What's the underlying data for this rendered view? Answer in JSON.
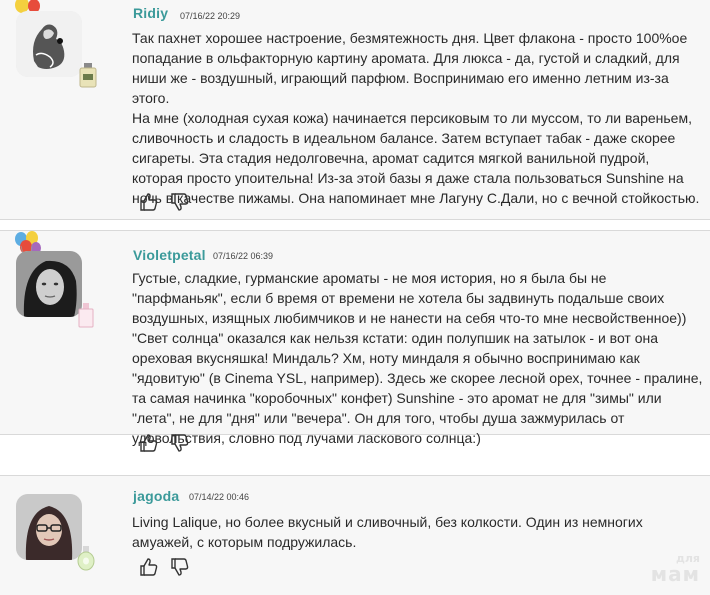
{
  "toolbar": {
    "icons": [
      "badge-icon",
      "thermometer-icon",
      "umbrella-icon",
      "thumbs-icon",
      "info-icon",
      "refresh-icon"
    ]
  },
  "reviews": [
    {
      "username": "Ridiy",
      "datetime": "07/16/22 20:29",
      "paragraphs": [
        "Так пахнет хорошее настроение, безмятежность дня. Цвет флакона - просто 100%ое попадание в ольфакторную картину аромата. Для люкса - да, густой и сладкий, для ниши же - воздушный, играющий парфюм. Воспринимаю его именно летним из-за этого.",
        "На мне (холодная сухая кожа) начинается персиковым то ли муссом, то ли вареньем, сливочность и сладость в идеальном балансе. Затем вступает табак - даже скорее сигареты. Эта стадия недолговечна, аромат садится мягкой ванильной пудрой, которая просто упоительна! Из-за этой базы я даже стала пользоваться Sunshine на ночь в качестве пижамы. Она напоминает мне Лагуну С.Дали, но с вечной стойкостью."
      ]
    },
    {
      "username": "Violetpetal",
      "datetime": "07/16/22 06:39",
      "paragraphs": [
        "Густые, сладкие, гурманские ароматы - не моя история, но я была бы не \"парфманьяк\", если б время от времени не хотела бы задвинуть подальше своих воздушных, изящных любимчиков и не нанести на себя что-то мне несвойственное)) \"Свет солнца\" оказался как нельзя кстати: один полупшик на затылок - и вот она ореховая вкусняшка! Миндаль? Хм, ноту миндаля я обычно воспринимаю как \"ядовитую\" (в Cinema YSL, например). Здесь же скорее лесной орех, точнее - пралине, та самая начинка \"коробочных\" конфет) Sunshine - это аромат не для \"зимы\" или \"лета\", не для \"дня\" или \"вечера\". Он для того, чтобы душа зажмурилась от удовольствия, словно под лучами ласкового солнца:)"
      ]
    },
    {
      "username": "jagoda",
      "datetime": "07/14/22 00:46",
      "paragraphs": [
        "Living Lalique, но более вкусный и сливочный, без колкости. Один из немногих амуажей, с которым подружилась."
      ]
    }
  ],
  "watermark": {
    "top": "для",
    "bottom": "мам"
  },
  "colors": {
    "username": "#3b9a9a",
    "background": "#f7f7f7",
    "border": "#d9d9d9"
  }
}
